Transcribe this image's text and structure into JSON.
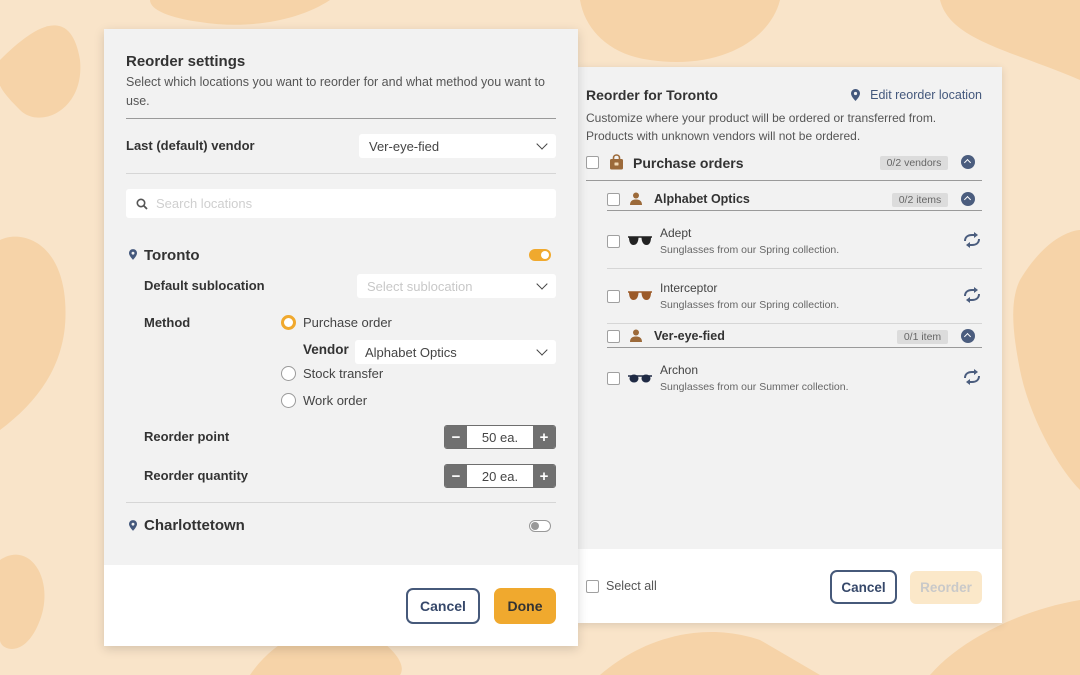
{
  "left_panel": {
    "title": "Reorder settings",
    "description": "Select which locations you want to reorder for and what method you want to use.",
    "vendor_label": "Last (default) vendor",
    "vendor_value": "Ver-eye-fied",
    "search_placeholder": "Search locations",
    "locations": [
      {
        "name": "Toronto",
        "enabled": true,
        "sublocation_label": "Default sublocation",
        "sublocation_placeholder": "Select sublocation",
        "method_label": "Method",
        "methods": [
          "Purchase order",
          "Stock transfer",
          "Work order"
        ],
        "selected_method": "Purchase order",
        "vendor_label": "Vendor",
        "vendor_value": "Alphabet Optics",
        "reorder_point_label": "Reorder point",
        "reorder_point_value": "50 ea.",
        "reorder_quantity_label": "Reorder quantity",
        "reorder_quantity_value": "20 ea."
      },
      {
        "name": "Charlottetown",
        "enabled": false
      }
    ],
    "cancel_label": "Cancel",
    "done_label": "Done"
  },
  "right_panel": {
    "title": "Reorder for Toronto",
    "edit_link": "Edit reorder location",
    "description": "Customize where your product will be ordered or transferred from. Products with unknown vendors will not be ordered.",
    "group": {
      "label": "Purchase orders",
      "badge": "0/2 vendors",
      "vendors": [
        {
          "name": "Alphabet Optics",
          "badge": "0/2 items",
          "items": [
            {
              "name": "Adept",
              "description": "Sunglasses from our Spring collection.",
              "color": "#222222"
            },
            {
              "name": "Interceptor",
              "description": "Sunglasses from our Spring collection.",
              "color": "#9c5a28"
            }
          ]
        },
        {
          "name": "Ver-eye-fied",
          "badge": "0/1 item",
          "items": [
            {
              "name": "Archon",
              "description": "Sunglasses from our Summer collection.",
              "color": "#1f2a44"
            }
          ]
        }
      ]
    },
    "select_all_label": "Select all",
    "cancel_label": "Cancel",
    "reorder_label": "Reorder"
  },
  "colors": {
    "accent": "#f0a92e",
    "navy": "#46597a",
    "background": "#f9e4c9",
    "blob": "#f6d3a8"
  }
}
